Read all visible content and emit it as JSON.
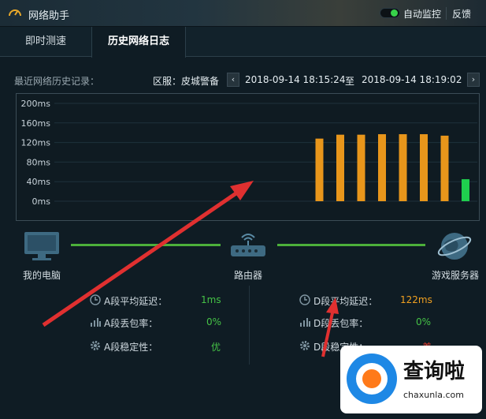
{
  "window": {
    "title": "网络助手",
    "auto_monitor_label": "自动监控",
    "feedback_label": "反馈"
  },
  "tabs": [
    {
      "label": "即时测速",
      "active": false
    },
    {
      "label": "历史网络日志",
      "active": true
    }
  ],
  "history": {
    "label": "最近网络历史记录：",
    "region": "区服：皮城警备",
    "start_time": "2018-09-14 18:15:24",
    "to_label": "至",
    "end_time": "2018-09-14 18:19:02"
  },
  "chart_data": {
    "type": "bar",
    "y_ticks": [
      "200ms",
      "160ms",
      "120ms",
      "80ms",
      "40ms",
      "0ms"
    ],
    "ylim": [
      0,
      200
    ],
    "values": [
      128,
      136,
      136,
      137,
      137,
      137,
      134,
      45
    ],
    "colors": [
      "#e8961b",
      "#e8961b",
      "#e8961b",
      "#e8961b",
      "#e8961b",
      "#e8961b",
      "#e8961b",
      "#1fcf4e"
    ],
    "grid": true
  },
  "nodes": {
    "pc": "我的电脑",
    "router": "路由器",
    "server": "游戏服务器"
  },
  "stats_a": {
    "latency_label": "A段平均延迟：",
    "latency_value": "1ms",
    "loss_label": "A段丢包率：",
    "loss_value": "0%",
    "stability_label": "A段稳定性：",
    "stability_value": "优"
  },
  "stats_d": {
    "latency_label": "D段平均延迟：",
    "latency_value": "122ms",
    "loss_label": "D段丢包率：",
    "loss_value": "0%",
    "stability_label": "D段稳定性：",
    "stability_value": "差"
  },
  "watermark": {
    "text": "查询啦",
    "url": "chaxunla.com"
  },
  "colors": {
    "accent_green": "#4cb03a",
    "value_green": "#45c246",
    "value_orange": "#f0a020",
    "value_red": "#e23b2e",
    "arrow_red": "#e03030"
  }
}
